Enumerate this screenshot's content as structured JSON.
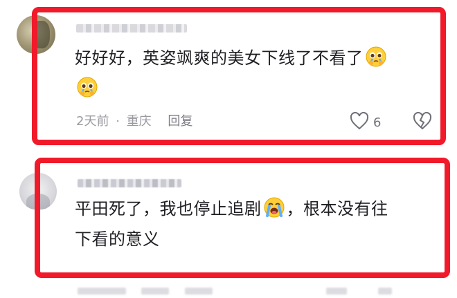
{
  "comments": [
    {
      "username": "",
      "text_line1": "好好好，英姿飒爽的美女下线了不看了",
      "text_line2": "",
      "time": "2天前",
      "separator": "·",
      "location": "重庆",
      "reply_label": "回复",
      "like_count": "6",
      "emoji": "pleading-tears-emoji"
    },
    {
      "username": "",
      "text_line1": "平田死了，我也停止追剧",
      "text_line1_suffix": "，根本没有往",
      "text_line2": "下看的意义",
      "emoji": "loudly-crying-emoji"
    }
  ],
  "colors": {
    "frame": "#f01a2a",
    "text": "#1f1f24",
    "meta": "#9a9aa2"
  },
  "icons": {
    "like": "heart-outline-icon",
    "dislike": "broken-heart-outline-icon"
  }
}
